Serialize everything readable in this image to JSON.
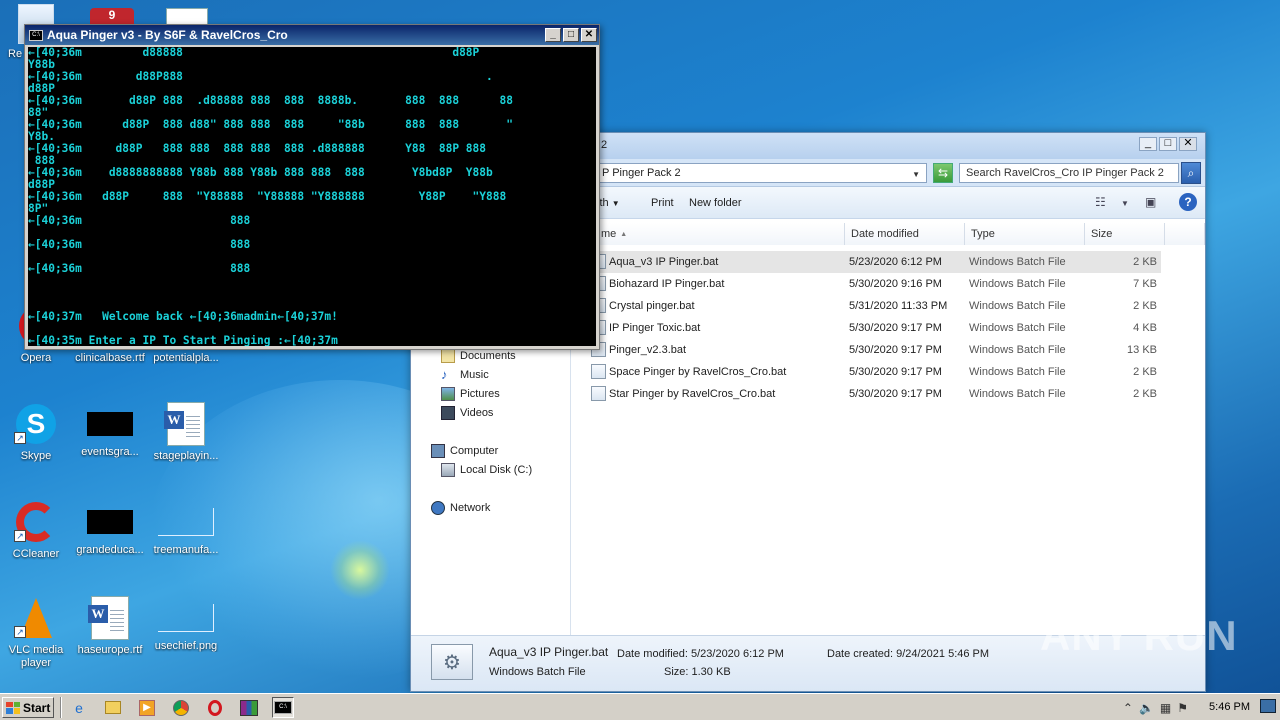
{
  "desktop": {
    "icons": [
      {
        "label": "Opera"
      },
      {
        "label": "clinicalbase.rtf"
      },
      {
        "label": "potentialpla..."
      },
      {
        "label": "Skype"
      },
      {
        "label": "eventsgra..."
      },
      {
        "label": "stageplayin..."
      },
      {
        "label": "CCleaner"
      },
      {
        "label": "grandeduca..."
      },
      {
        "label": "treemanufa..."
      },
      {
        "label": "VLC media player"
      },
      {
        "label": "haseurope.rtf"
      },
      {
        "label": "usechief.png"
      }
    ],
    "partial_labels": {
      "recycle": "Re"
    }
  },
  "cmd": {
    "title": "Aqua Pinger v3 - By S6F & RavelCros_Cro",
    "text_color": "#1bd1d8",
    "lines": [
      "←[40;36m         d88888                                        d88P",
      "Y88b",
      "←[40;36m        d88P888                                             .",
      "d88P",
      "←[40;36m       d88P 888  .d88888 888  888  8888b.       888  888      88",
      "88\"",
      "←[40;36m      d88P  888 d88\" 888 888  888     \"88b      888  888       \"",
      "Y8b.",
      "←[40;36m     d88P   888 888  888 888  888 .d888888      Y88  88P 888",
      " 888",
      "←[40;36m    d8888888888 Y88b 888 Y88b 888 888  888       Y8bd8P  Y88b",
      "d88P",
      "←[40;36m   d88P     888  \"Y88888  \"Y88888 \"Y888888        Y88P    \"Y888",
      "8P\"",
      "←[40;36m                      888",
      "",
      "←[40;36m                      888",
      "",
      "←[40;36m                      888",
      "",
      "",
      "",
      "←[40;37m   Welcome back ←[40;36madmin←[40;37m!",
      "",
      "←[40;35m Enter a IP To Start Pinging :←[40;37m"
    ]
  },
  "explorer": {
    "title_fragment": "2",
    "address": "P Pinger Pack 2",
    "search_placeholder": "Search RavelCros_Cro IP Pinger Pack 2",
    "toolbar": {
      "share_with": "ith",
      "print": "Print",
      "new_folder": "New folder"
    },
    "columns": {
      "name": "me",
      "date": "Date modified",
      "type": "Type",
      "size": "Size"
    },
    "nav": {
      "documents": "Documents",
      "music": "Music",
      "pictures": "Pictures",
      "videos": "Videos",
      "computer": "Computer",
      "local_disk": "Local Disk (C:)",
      "network": "Network"
    },
    "files": [
      {
        "name": "Aqua_v3 IP Pinger.bat",
        "date": "5/23/2020 6:12 PM",
        "type": "Windows Batch File",
        "size": "2 KB"
      },
      {
        "name": "Biohazard IP Pinger.bat",
        "date": "5/30/2020 9:16 PM",
        "type": "Windows Batch File",
        "size": "7 KB"
      },
      {
        "name": "Crystal pinger.bat",
        "date": "5/31/2020 11:33 PM",
        "type": "Windows Batch File",
        "size": "2 KB"
      },
      {
        "name": "IP Pinger Toxic.bat",
        "date": "5/30/2020 9:17 PM",
        "type": "Windows Batch File",
        "size": "4 KB"
      },
      {
        "name": "Pinger_v2.3.bat",
        "date": "5/30/2020 9:17 PM",
        "type": "Windows Batch File",
        "size": "13 KB"
      },
      {
        "name": "Space Pinger by RavelCros_Cro.bat",
        "date": "5/30/2020 9:17 PM",
        "type": "Windows Batch File",
        "size": "2 KB"
      },
      {
        "name": "Star Pinger by RavelCros_Cro.bat",
        "date": "5/30/2020 9:17 PM",
        "type": "Windows Batch File",
        "size": "2 KB"
      }
    ],
    "details": {
      "file_name": "Aqua_v3 IP Pinger.bat",
      "modified": "Date modified: 5/23/2020 6:12 PM",
      "created": "Date created: 9/24/2021 5:46 PM",
      "type": "Windows Batch File",
      "size": "Size: 1.30 KB"
    }
  },
  "watermark": "ANY RUN",
  "taskbar": {
    "start": "Start",
    "clock": "5:46 PM"
  }
}
